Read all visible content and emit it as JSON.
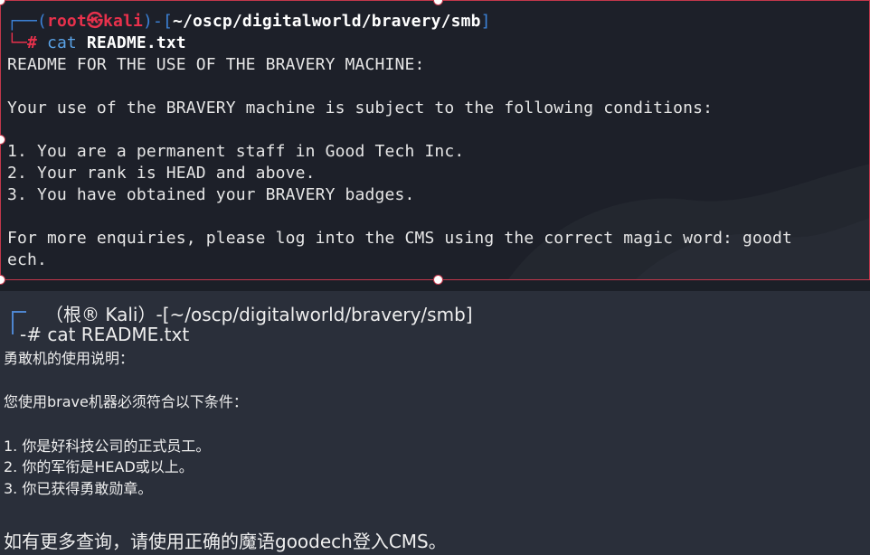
{
  "top_terminal": {
    "prompt": {
      "open": "┌──(",
      "user": "root㉿kali",
      "close_open": ")-[",
      "path": "~/oscp/digitalworld/bravery/smb",
      "close": "]",
      "hash": "└─# ",
      "command": "cat",
      "argument": "README.txt"
    },
    "output": [
      "README FOR THE USE OF THE BRAVERY MACHINE:",
      "",
      "Your use of the BRAVERY machine is subject to the following conditions:",
      "",
      "1. You are a permanent staff in Good Tech Inc.",
      "2. Your rank is HEAD and above.",
      "3. You have obtained your BRAVERY badges.",
      "",
      "For more enquiries, please log into the CMS using the correct magic word: goodt",
      "ech."
    ]
  },
  "bottom_translation": {
    "prompt": "（根® Kali）-[~/oscp/digitalworld/bravery/smb]",
    "command": "-# cat README.txt",
    "lines": [
      "勇敢机的使用说明：",
      "您使用brave机器必须符合以下条件：",
      "1. 你是好科技公司的正式员工。",
      "2. 你的军衔是HEAD或以上。",
      "3. 你已获得勇敢勋章。",
      "如有更多查询，请使用正确的魔语goodech登入CMS。"
    ]
  },
  "colors": {
    "terminal_bg": "#1d2029",
    "selection_border": "#c2374b",
    "prompt_user": "#e8314c",
    "prompt_bracket": "#3c82d8",
    "command": "#5aa2e6",
    "translation_bg": "#2a2f3a"
  }
}
